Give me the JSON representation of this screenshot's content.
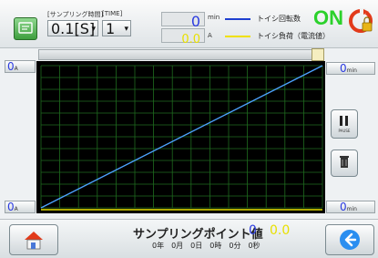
{
  "header": {
    "sampling_time_label": "[サンプリング時間]",
    "time_label": "[TIME]",
    "sampling_time_value": "0.1[S]",
    "time_value": "1",
    "rpm_value": "0",
    "rpm_unit": "min",
    "current_value": "0.0",
    "current_unit": "A",
    "legend": [
      {
        "label": "トイシ回転数",
        "color": "#1f3fd0"
      },
      {
        "label": "トイシ負荷（電流値）",
        "color": "#f0e000"
      }
    ],
    "status": "ON"
  },
  "axes": {
    "left_top": "0",
    "left_top_unit": "A",
    "left_bottom": "0",
    "left_bottom_unit": "A",
    "right_top": "0",
    "right_top_unit": "min",
    "right_bottom": "0",
    "right_bottom_unit": "min"
  },
  "chart_data": {
    "type": "line",
    "series": [
      {
        "color": "#4da3ff",
        "x": [
          0,
          1
        ],
        "y": [
          0,
          1
        ]
      }
    ],
    "grid": true
  },
  "side": {
    "pause_label": "PAUSE"
  },
  "footer": {
    "title": "サンプリングポイント値",
    "value1": "0",
    "value2": "0.0",
    "timestamp": "0年　0月　0日　0時　0分　0秒"
  },
  "colors": {
    "accent_blue": "#2b3be0",
    "on_green": "#2bd12b",
    "current_yellow": "#e8e000",
    "grid_green": "#1f6b1f"
  }
}
